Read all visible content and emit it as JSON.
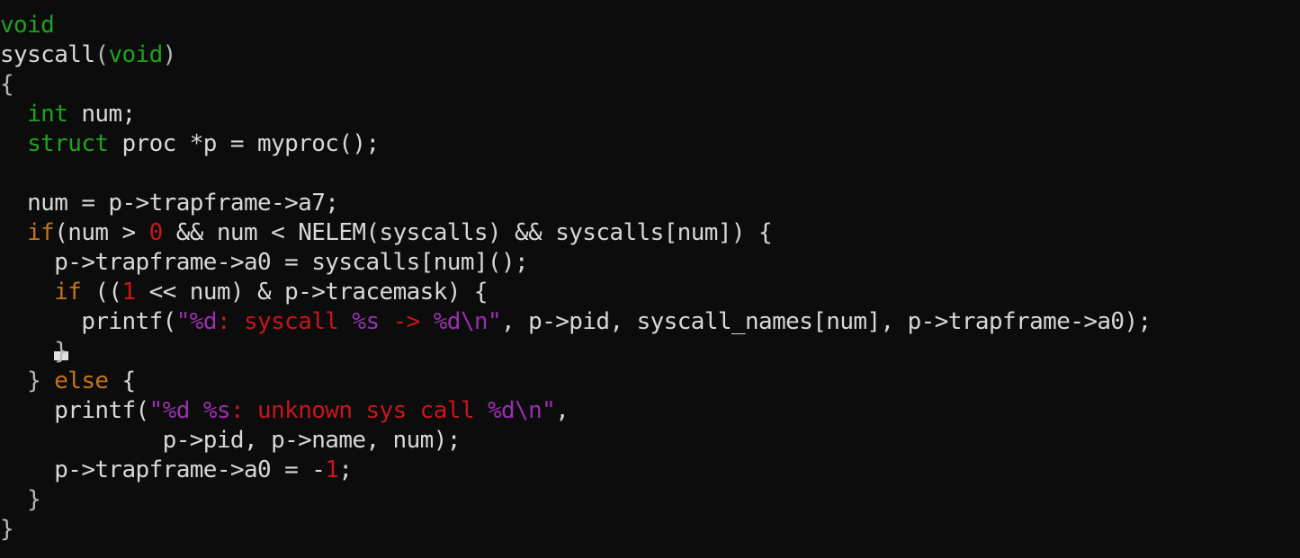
{
  "editor": {
    "colors": {
      "background": "#0c0c0c",
      "plain": "#d8d8d8",
      "type": "#1fa21f",
      "keyword": "#c4731c",
      "number": "#c8161b",
      "string": "#c8161b",
      "format": "#9a2fb0"
    },
    "cursor_line": 11,
    "lines": [
      [
        {
          "k": "type",
          "t": "void"
        }
      ],
      [
        {
          "k": "plain",
          "t": "syscall"
        },
        {
          "k": "paren",
          "t": "("
        },
        {
          "k": "type",
          "t": "void"
        },
        {
          "k": "paren",
          "t": ")"
        }
      ],
      [
        {
          "k": "brace",
          "t": "{"
        }
      ],
      [
        {
          "k": "plain",
          "t": "  "
        },
        {
          "k": "type",
          "t": "int"
        },
        {
          "k": "plain",
          "t": " num;"
        }
      ],
      [
        {
          "k": "plain",
          "t": "  "
        },
        {
          "k": "type",
          "t": "struct"
        },
        {
          "k": "plain",
          "t": " proc *p = myproc();"
        }
      ],
      [
        {
          "k": "plain",
          "t": ""
        }
      ],
      [
        {
          "k": "plain",
          "t": "  num = p->trapframe->a7;"
        }
      ],
      [
        {
          "k": "plain",
          "t": "  "
        },
        {
          "k": "keyword",
          "t": "if"
        },
        {
          "k": "plain",
          "t": "(num > "
        },
        {
          "k": "number",
          "t": "0"
        },
        {
          "k": "plain",
          "t": " && num < NELEM(syscalls) && syscalls[num]) {"
        }
      ],
      [
        {
          "k": "plain",
          "t": "    p->trapframe->a0 = syscalls[num]();"
        }
      ],
      [
        {
          "k": "plain",
          "t": "    "
        },
        {
          "k": "keyword",
          "t": "if"
        },
        {
          "k": "plain",
          "t": " (("
        },
        {
          "k": "number",
          "t": "1"
        },
        {
          "k": "plain",
          "t": " << num) & p->tracemask) {"
        }
      ],
      [
        {
          "k": "plain",
          "t": "      printf("
        },
        {
          "k": "quote",
          "t": "\""
        },
        {
          "k": "format",
          "t": "%d"
        },
        {
          "k": "string",
          "t": ": syscall "
        },
        {
          "k": "format",
          "t": "%s"
        },
        {
          "k": "string",
          "t": " -> "
        },
        {
          "k": "format",
          "t": "%d\\n"
        },
        {
          "k": "quote",
          "t": "\""
        },
        {
          "k": "plain",
          "t": ", p->pid, syscall_names[num], p->trapframe->a0);"
        }
      ],
      [
        {
          "k": "plain",
          "t": "    "
        },
        {
          "k": "brace",
          "t": "}"
        }
      ],
      [
        {
          "k": "plain",
          "t": "  "
        },
        {
          "k": "brace",
          "t": "}"
        },
        {
          "k": "plain",
          "t": " "
        },
        {
          "k": "keyword",
          "t": "else"
        },
        {
          "k": "plain",
          "t": " {"
        }
      ],
      [
        {
          "k": "plain",
          "t": "    printf("
        },
        {
          "k": "quote",
          "t": "\""
        },
        {
          "k": "format",
          "t": "%d %s"
        },
        {
          "k": "string",
          "t": ": unknown sys call "
        },
        {
          "k": "format",
          "t": "%d\\n"
        },
        {
          "k": "quote",
          "t": "\""
        },
        {
          "k": "plain",
          "t": ","
        }
      ],
      [
        {
          "k": "plain",
          "t": "            p->pid, p->name, num);"
        }
      ],
      [
        {
          "k": "plain",
          "t": "    p->trapframe->a0 = -"
        },
        {
          "k": "number",
          "t": "1"
        },
        {
          "k": "plain",
          "t": ";"
        }
      ],
      [
        {
          "k": "plain",
          "t": "  "
        },
        {
          "k": "brace",
          "t": "}"
        }
      ],
      [
        {
          "k": "brace",
          "t": "}"
        }
      ]
    ]
  }
}
